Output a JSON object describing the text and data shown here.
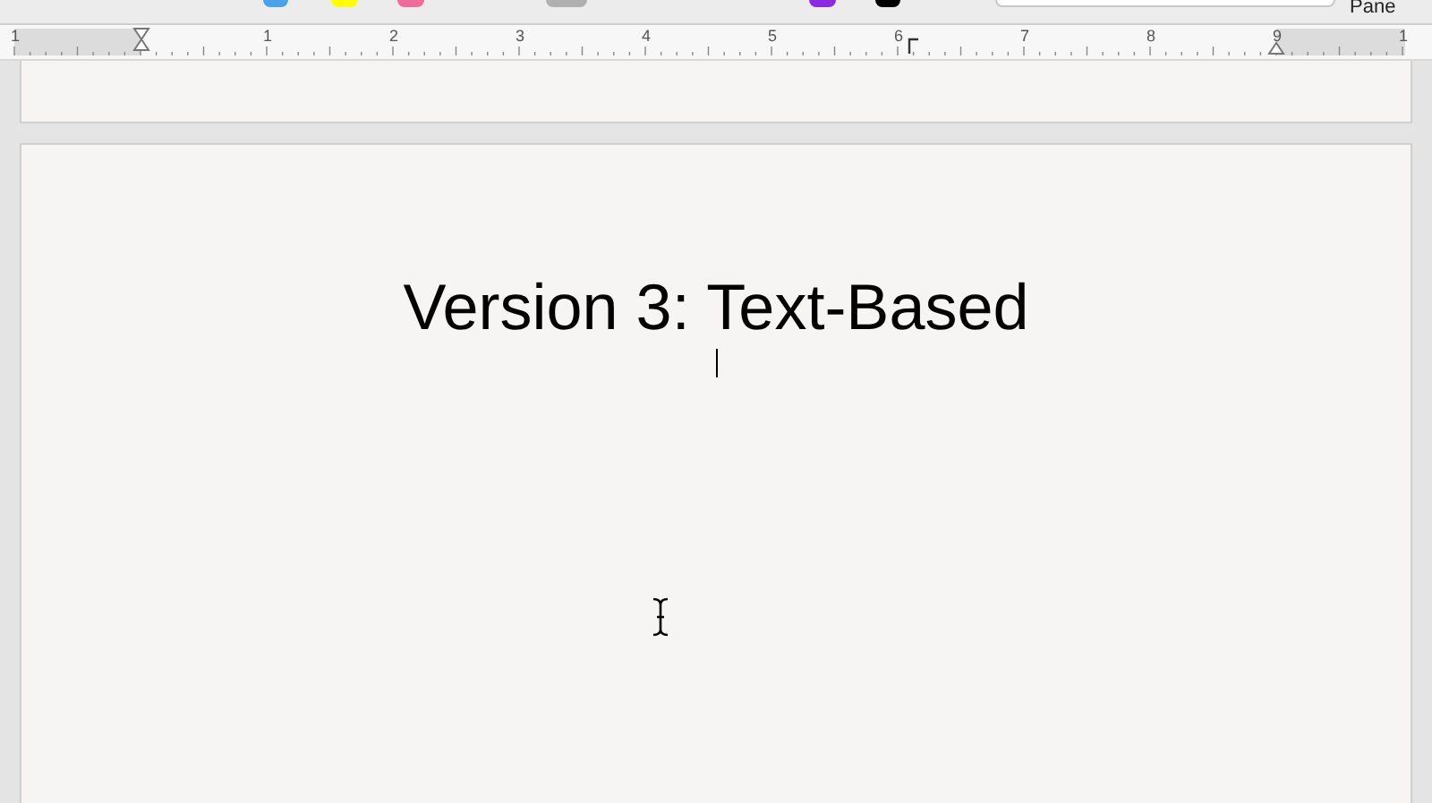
{
  "toolbar": {
    "swatches": [
      {
        "color": "#4aa3e8"
      },
      {
        "color": "#ffff00"
      },
      {
        "color": "#f06a9a"
      },
      {
        "color": "#b0b0b0"
      },
      {
        "color": "#8a2be2"
      },
      {
        "color": "#000000"
      }
    ],
    "pane_label": "Pane"
  },
  "ruler": {
    "labels": [
      "1",
      "1",
      "2",
      "3",
      "4",
      "5",
      "6",
      "7",
      "8",
      "9",
      "1"
    ]
  },
  "document": {
    "title": "Version 3: Text-Based"
  }
}
